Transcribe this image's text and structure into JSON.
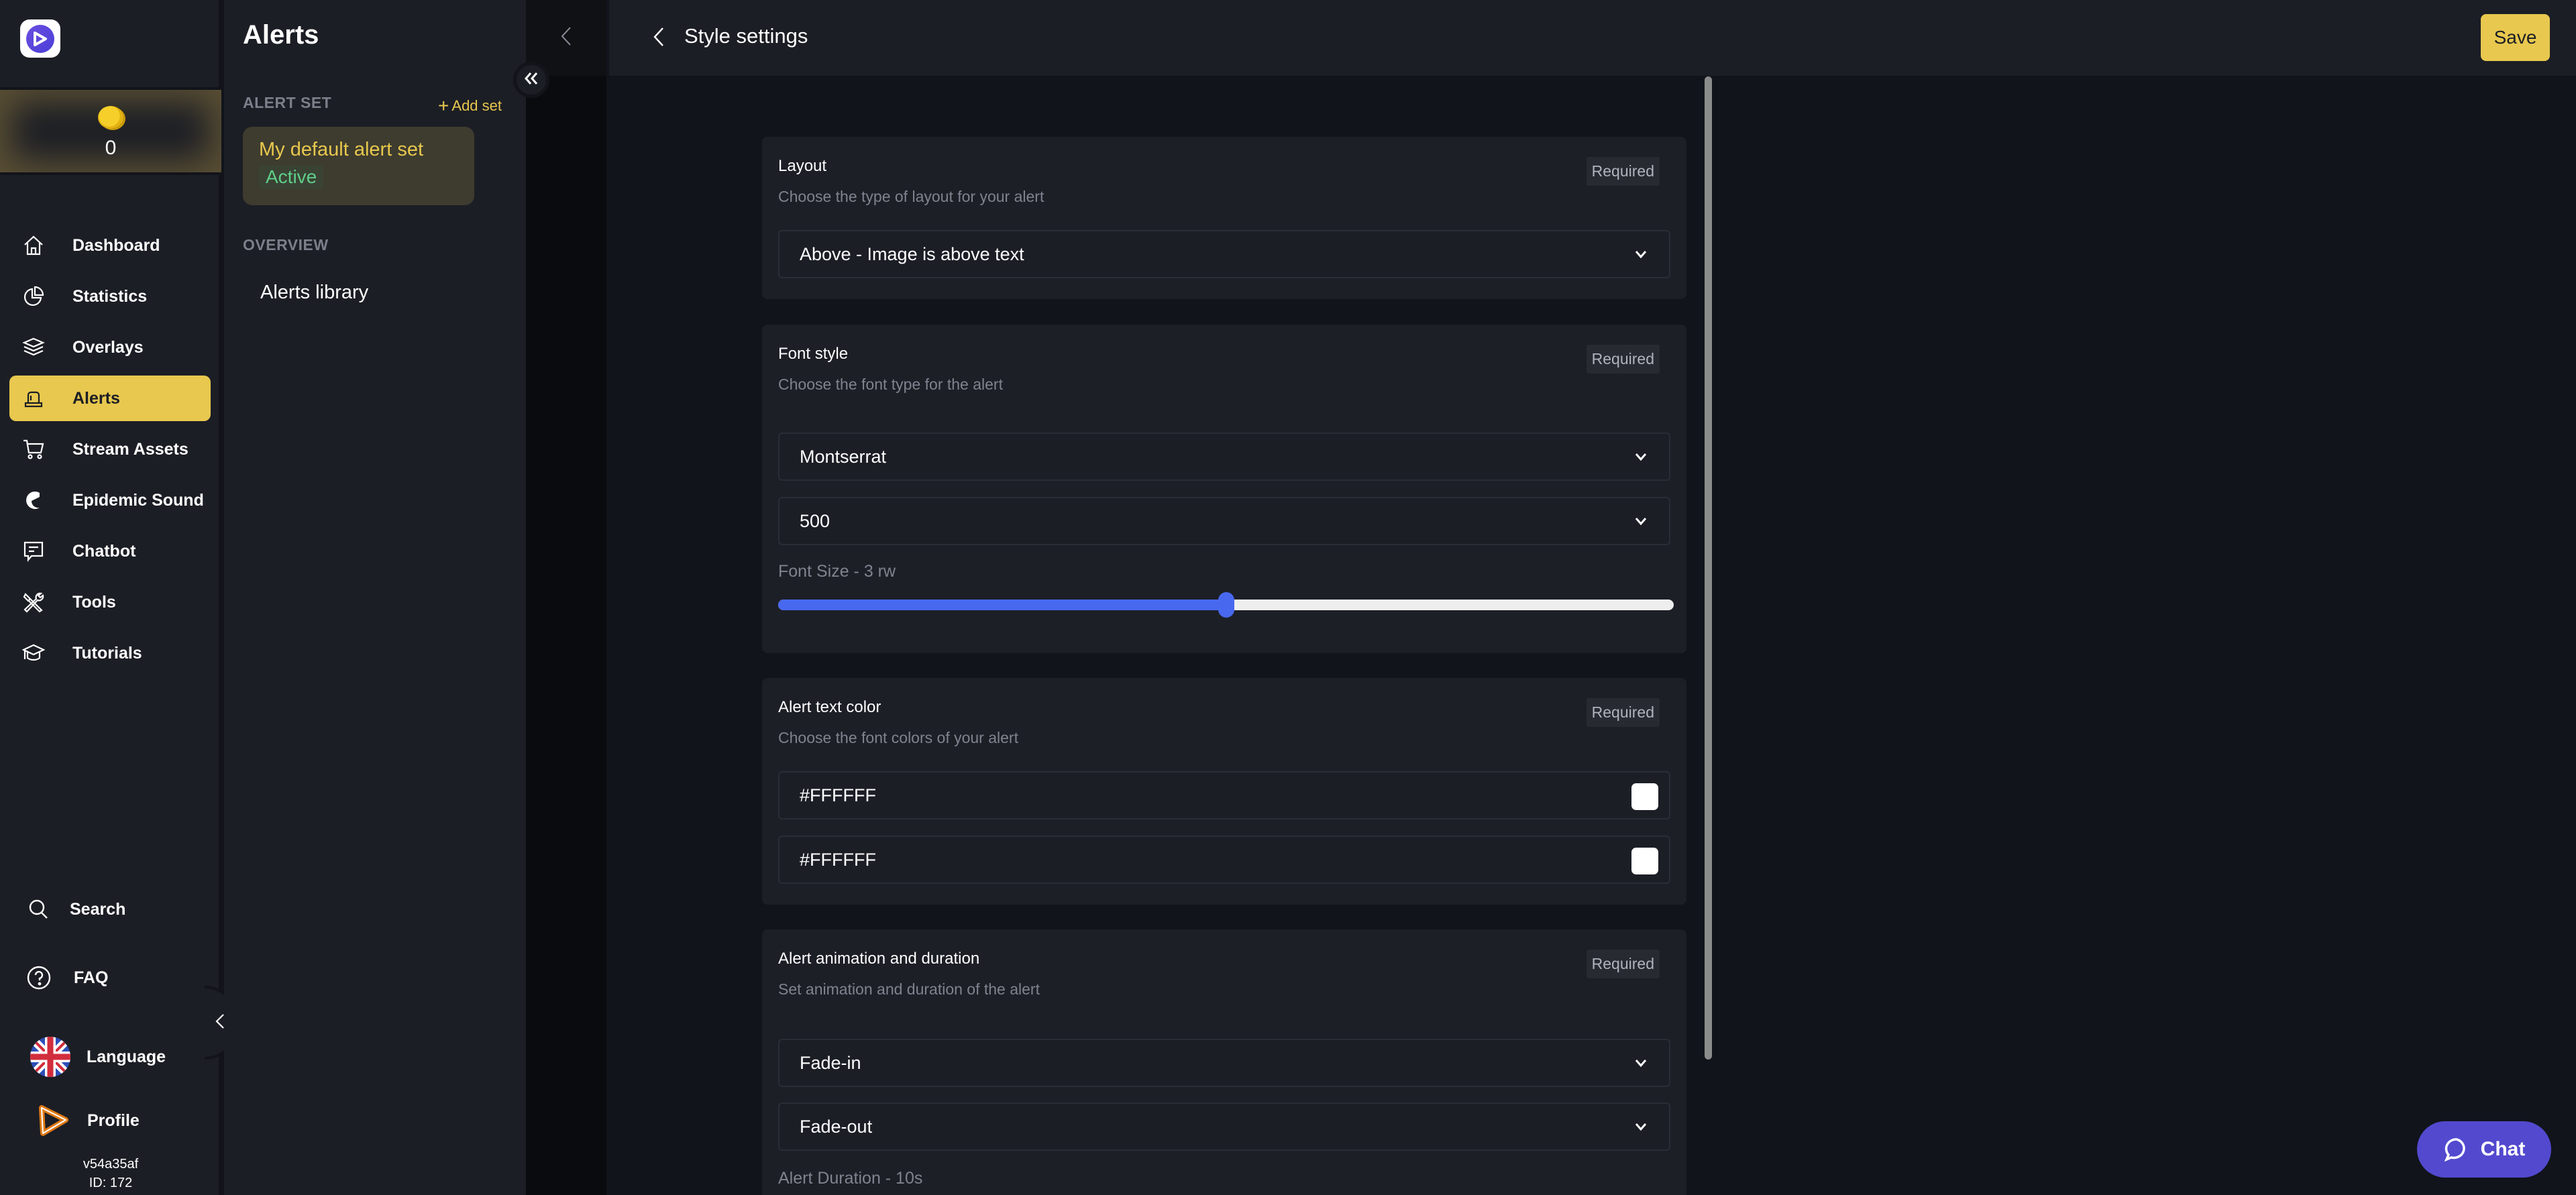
{
  "colors": {
    "accent": "#e8c84e",
    "active_green": "#5fcf8a",
    "slider_fill": "#4869ef",
    "chat_button": "#5249cf"
  },
  "nav": {
    "coins": "0",
    "items": [
      {
        "label": "Dashboard",
        "icon": "home-icon"
      },
      {
        "label": "Statistics",
        "icon": "pie-chart-icon"
      },
      {
        "label": "Overlays",
        "icon": "layers-icon"
      },
      {
        "label": "Alerts",
        "icon": "alert-siren-icon",
        "active": true
      },
      {
        "label": "Stream Assets",
        "icon": "cart-icon"
      },
      {
        "label": "Epidemic Sound",
        "icon": "epidemic-sound-icon"
      },
      {
        "label": "Chatbot",
        "icon": "chat-bubble-icon"
      },
      {
        "label": "Tools",
        "icon": "tools-icon"
      },
      {
        "label": "Tutorials",
        "icon": "graduation-cap-icon"
      }
    ],
    "bottom": {
      "search": "Search",
      "faq": "FAQ",
      "language": "Language",
      "profile": "Profile"
    },
    "version": "v54a35af",
    "user_id": "ID: 172"
  },
  "panel": {
    "title": "Alerts",
    "alert_set_label": "ALERT SET",
    "add_set": "Add set",
    "alert_set": {
      "name": "My default alert set",
      "status": "Active"
    },
    "overview_label": "OVERVIEW",
    "overview_link": "Alerts library"
  },
  "main": {
    "title": "Style settings",
    "save": "Save",
    "cards": {
      "layout": {
        "title": "Layout",
        "desc": "Choose the type of layout for your alert",
        "required": "Required",
        "value": "Above - Image is above text"
      },
      "font": {
        "title": "Font style",
        "desc": "Choose the font type for the alert",
        "required": "Required",
        "family": "Montserrat",
        "weight": "500",
        "size_label": "Font Size - 3 rw",
        "size_slider_fraction": 0.5
      },
      "color": {
        "title": "Alert text color",
        "desc": "Choose the font colors of your alert",
        "required": "Required",
        "color1": "#FFFFFF",
        "color2": "#FFFFFF"
      },
      "animation": {
        "title": "Alert animation and duration",
        "desc": "Set animation and duration of the alert",
        "required": "Required",
        "in": "Fade-in",
        "out": "Fade-out",
        "duration_label": "Alert Duration - 10s"
      }
    }
  },
  "chat": {
    "label": "Chat"
  }
}
